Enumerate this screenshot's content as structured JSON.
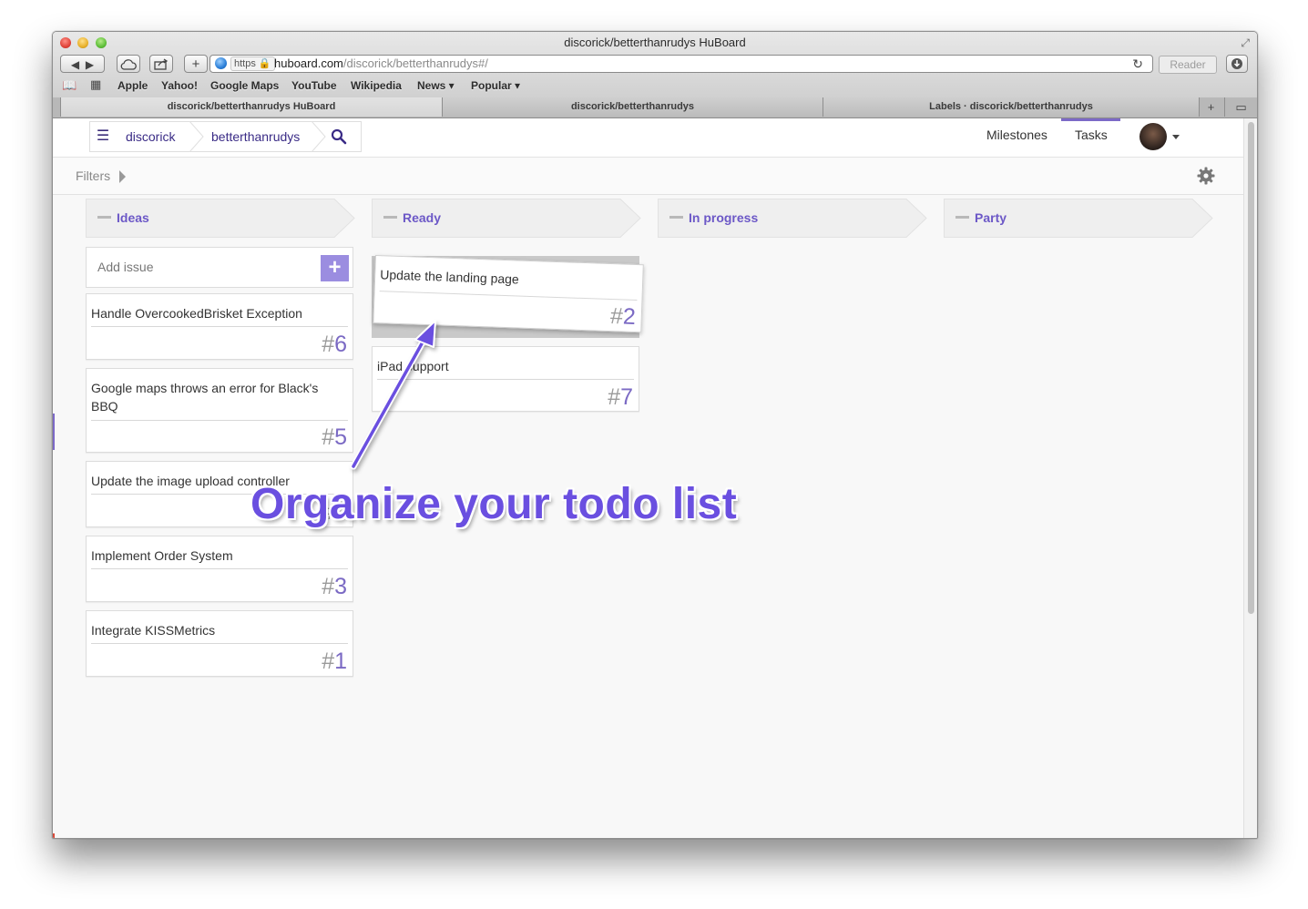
{
  "window": {
    "title": "discorick/betterthanrudys HuBoard"
  },
  "toolbar": {
    "back_icon": "back-arrow",
    "forward_icon": "forward-arrow",
    "icloud_icon": "cloud",
    "share_icon": "share",
    "new_tab_label": "+",
    "url_scheme_badge": "https",
    "url_host": "huboard.com",
    "url_path": "/discorick/betterthanrudys#/",
    "reload_icon": "↻",
    "reader_label": "Reader",
    "downloads_icon": "download"
  },
  "bookmarks": {
    "items": [
      "Apple",
      "Yahoo!",
      "Google Maps",
      "YouTube",
      "Wikipedia",
      "News ▾",
      "Popular ▾"
    ]
  },
  "tabs": [
    {
      "label": "discorick/betterthanrudys HuBoard",
      "active": true
    },
    {
      "label": "discorick/betterthanrudys",
      "active": false
    },
    {
      "label": "Labels · discorick/betterthanrudys",
      "active": false
    }
  ],
  "app": {
    "breadcrumb": {
      "user": "discorick",
      "repo": "betterthanrudys"
    },
    "nav": {
      "milestones": "Milestones",
      "tasks": "Tasks",
      "active": "Tasks"
    },
    "filters_label": "Filters",
    "accent_color": "#6c58c7",
    "columns": [
      {
        "label": "Ideas"
      },
      {
        "label": "Ready"
      },
      {
        "label": "In progress"
      },
      {
        "label": "Party"
      }
    ],
    "add_issue": {
      "placeholder": "Add issue",
      "button": "+"
    },
    "ideas_cards": [
      {
        "title": "Handle OvercookedBrisket Exception",
        "number": "6"
      },
      {
        "title": "Google maps throws an error for Black's BBQ",
        "number": "5"
      },
      {
        "title": "Update the image upload controller",
        "number": "4"
      },
      {
        "title": "Implement Order System",
        "number": "3"
      },
      {
        "title": "Integrate KISSMetrics",
        "number": "1"
      }
    ],
    "ready_cards": [
      {
        "title": "Update the landing page",
        "number": "2",
        "dragging": true
      },
      {
        "title": "iPad support",
        "number": "7"
      }
    ]
  },
  "overlay": {
    "caption": "Organize your todo list",
    "color": "#6a4fe0"
  }
}
